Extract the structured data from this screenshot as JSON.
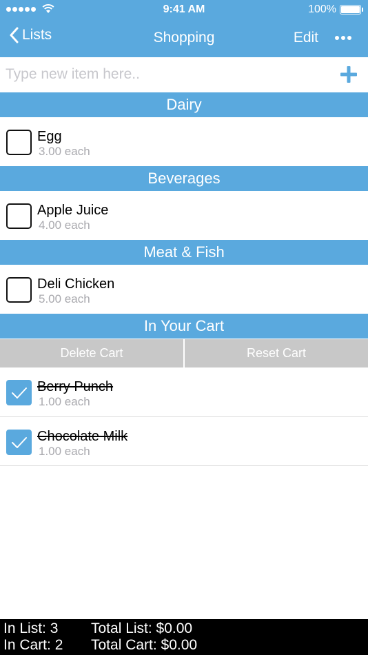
{
  "status_bar": {
    "time": "9:41 AM",
    "battery": "100%"
  },
  "nav": {
    "back_label": "Lists",
    "title": "Shopping",
    "edit_label": "Edit"
  },
  "new_item": {
    "placeholder": "Type new item here.."
  },
  "sections": [
    {
      "title": "Dairy",
      "items": [
        {
          "name": "Egg",
          "price": "3.00 each",
          "checked": false
        }
      ]
    },
    {
      "title": "Beverages",
      "items": [
        {
          "name": "Apple Juice",
          "price": "4.00 each",
          "checked": false
        }
      ]
    },
    {
      "title": "Meat & Fish",
      "items": [
        {
          "name": "Deli Chicken",
          "price": "5.00 each",
          "checked": false
        }
      ]
    }
  ],
  "cart": {
    "title": "In Your Cart",
    "delete_label": "Delete Cart",
    "reset_label": "Reset Cart",
    "items": [
      {
        "name": "Berry Punch",
        "price": "1.00 each",
        "checked": true
      },
      {
        "name": "Chocolate Milk",
        "price": "1.00 each",
        "checked": true
      }
    ]
  },
  "footer": {
    "in_list": "In List: 3",
    "in_cart": "In Cart: 2",
    "total_list": "Total List: $0.00",
    "total_cart": "Total Cart: $0.00"
  },
  "colors": {
    "accent": "#5aa9de",
    "button_gray": "#c8c8c8",
    "footer_bg": "#000000"
  },
  "icons": [
    "signal-dots-icon",
    "wifi-icon",
    "battery-icon",
    "chevron-left-icon",
    "more-icon",
    "plus-icon",
    "checkmark-icon"
  ]
}
